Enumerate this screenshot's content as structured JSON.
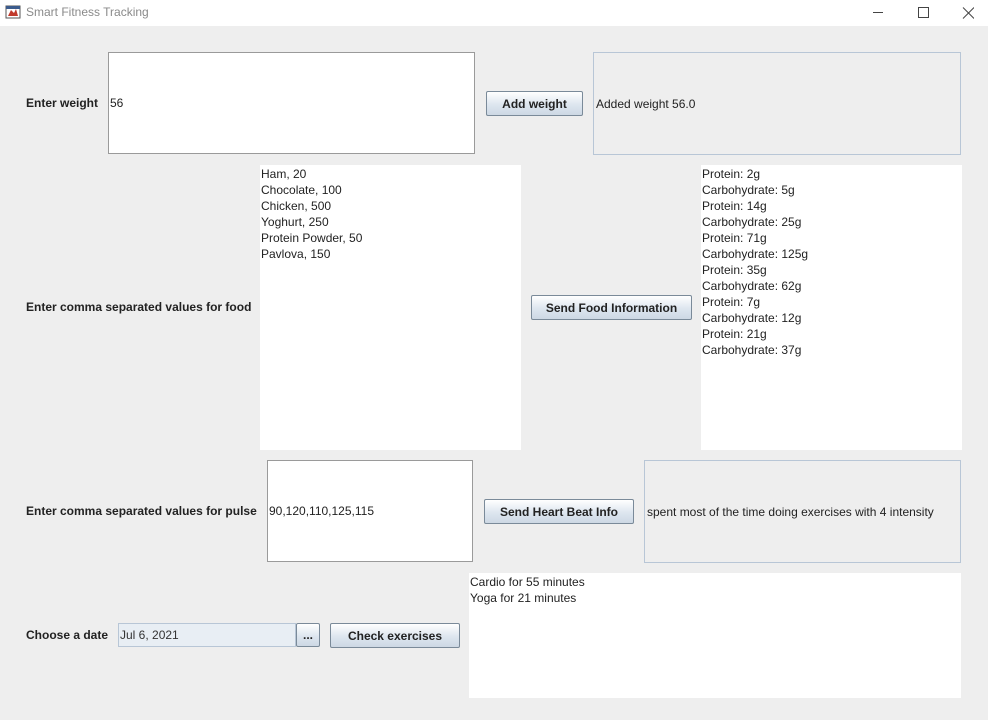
{
  "window": {
    "title": "Smart Fitness Tracking",
    "icons": [
      "app-icon",
      "minimize-icon",
      "maximize-icon",
      "close-icon"
    ]
  },
  "weight": {
    "label": "Enter weight",
    "input_value": "56",
    "button_label": "Add weight",
    "result": "Added weight 56.0"
  },
  "food": {
    "label": "Enter comma separated values for food",
    "input_lines": [
      "Ham, 20",
      "Chocolate, 100",
      "Chicken, 500",
      "Yoghurt, 250",
      "Protein Powder, 50",
      "Pavlova, 150"
    ],
    "button_label": "Send Food Information",
    "output_lines": [
      "Protein: 2g",
      "Carbohydrate: 5g",
      "Protein: 14g",
      "Carbohydrate: 25g",
      "Protein: 71g",
      "Carbohydrate: 125g",
      "Protein: 35g",
      "Carbohydrate: 62g",
      "Protein: 7g",
      "Carbohydrate: 12g",
      "Protein: 21g",
      "Carbohydrate: 37g"
    ]
  },
  "pulse": {
    "label": "Enter comma separated values for pulse",
    "input_value": "90,120,110,125,115",
    "button_label": "Send Heart Beat Info",
    "result": "spent most of the time doing exercises with 4 intensity"
  },
  "exercise": {
    "label": "Choose a date",
    "date_value": "Jul 6, 2021",
    "picker_label": "...",
    "button_label": "Check exercises",
    "output_lines": [
      "Cardio for 55 minutes",
      "Yoga for 21 minutes"
    ]
  }
}
